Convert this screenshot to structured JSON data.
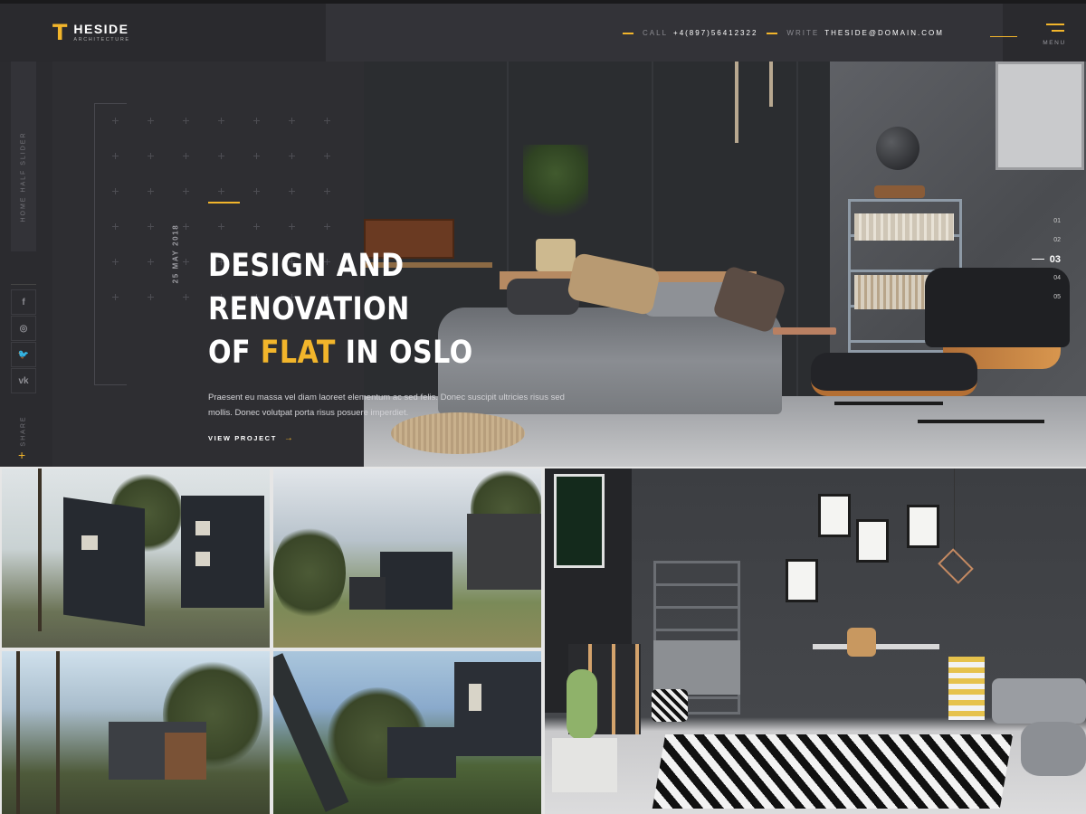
{
  "header": {
    "logo_mark": "T",
    "logo_name": "HESIDE",
    "logo_sub": "ARCHITECTURE",
    "call_label": "CALL",
    "call_value": "+4(897)56412322",
    "write_label": "WRITE",
    "write_value": "THESIDE@DOMAIN.COM",
    "menu_label": "MENU"
  },
  "sidebar": {
    "vertical_text": "HOME HALF SLIDER",
    "social": [
      {
        "icon": "facebook-icon",
        "glyph": "f"
      },
      {
        "icon": "instagram-icon",
        "glyph": "◎"
      },
      {
        "icon": "twitter-icon",
        "glyph": "🐦"
      },
      {
        "icon": "vk-icon",
        "glyph": "vk"
      }
    ],
    "share_label": "SHARE",
    "share_plus": "+"
  },
  "hero": {
    "date": "25 MAY 2018",
    "headline_line1": "DESIGN AND",
    "headline_line2": "RENOVATION",
    "headline_line3_pre": "OF",
    "headline_line3_highlight": "FLAT",
    "headline_line3_post": "IN OSLO",
    "description": "Praesent eu massa vel diam laoreet elementum ac sed felis. Donec suscipit ultricies risus sed mollis. Donec volutpat porta risus posuere imperdiet.",
    "view_link": "VIEW PROJECT",
    "view_arrow": "→"
  },
  "pager": {
    "items": [
      "01",
      "02",
      "03",
      "04",
      "05"
    ],
    "active_index": 2
  },
  "colors": {
    "accent": "#f2b52b",
    "dark_bg": "#2e2e32",
    "header_bg": "#2a2a2e"
  }
}
